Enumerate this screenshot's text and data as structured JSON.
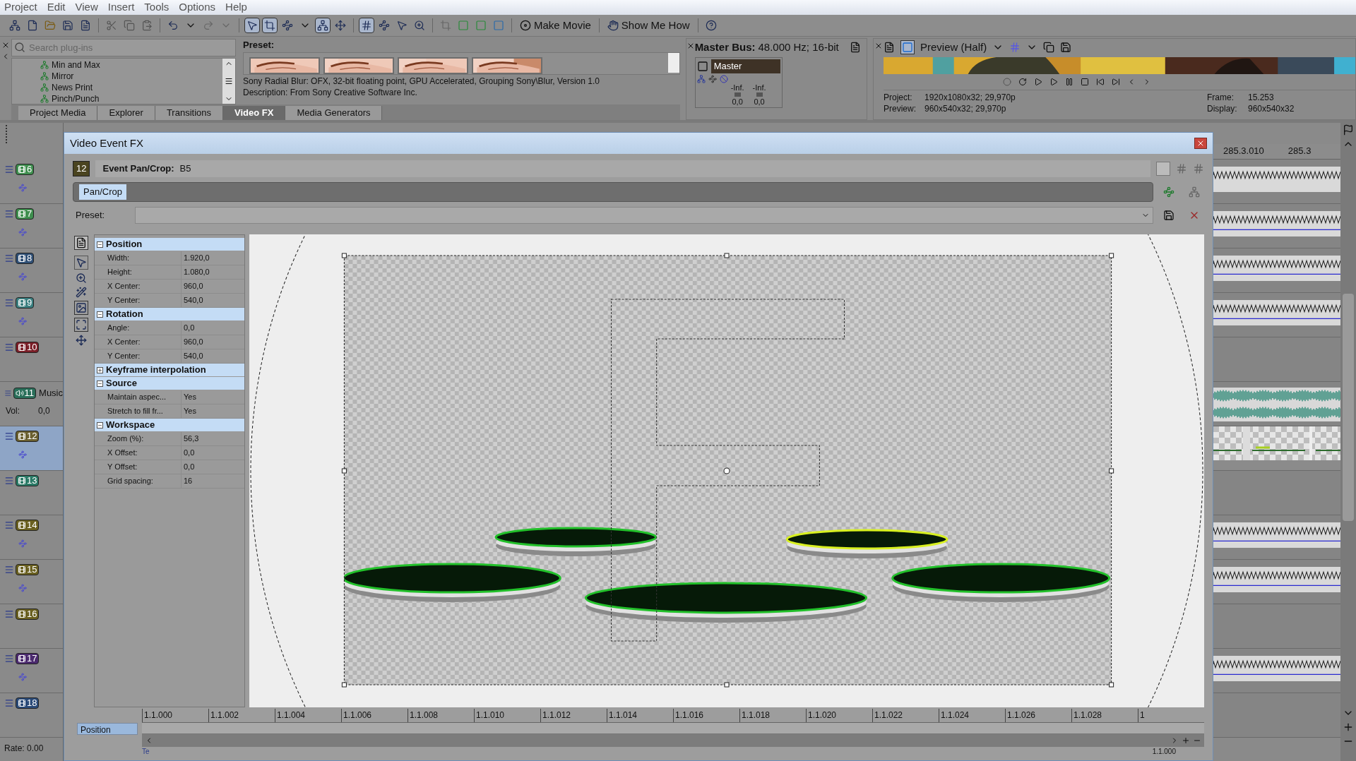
{
  "menu": [
    "Project",
    "Edit",
    "View",
    "Insert",
    "Tools",
    "Options",
    "Help"
  ],
  "toolbar": {
    "make_movie": "Make Movie",
    "show_me_how": "Show Me How"
  },
  "plugins": {
    "search_placeholder": "Search plug-ins",
    "items": [
      "Min and Max",
      "Mirror",
      "News Print",
      "Pinch/Punch"
    ],
    "preset_label": "Preset:",
    "info": "Sony Radial Blur: OFX, 32-bit floating point, GPU Accelerated, Grouping Sony\\Blur, Version 1.0",
    "description": "Description: From Sony Creative Software Inc."
  },
  "dock_tabs": [
    {
      "label": "Project Media",
      "selected": false
    },
    {
      "label": "Explorer",
      "selected": false
    },
    {
      "label": "Transitions",
      "selected": false
    },
    {
      "label": "Video FX",
      "selected": true
    },
    {
      "label": "Media Generators",
      "selected": false
    }
  ],
  "master_bus": {
    "title": "Master Bus:",
    "format": "48.000 Hz; 16-bit",
    "channel": "Master",
    "meters": [
      {
        "peak": "-Inf.",
        "value": "0,0"
      },
      {
        "peak": "-Inf.",
        "value": "0,0"
      }
    ]
  },
  "preview": {
    "mode": "Preview (Half)",
    "info": [
      {
        "label": "Project:",
        "value": "1920x1080x32; 29,970p"
      },
      {
        "label": "Preview:",
        "value": "960x540x32; 29,970p"
      },
      {
        "label": "Frame:",
        "value": "15.253"
      },
      {
        "label": "Display:",
        "value": "960x540x32"
      }
    ]
  },
  "tracks": [
    {
      "number": "6",
      "kind": "video",
      "color": "#3f8f4f",
      "selected": false,
      "event": true
    },
    {
      "number": "7",
      "kind": "video",
      "color": "#3f8f4f",
      "selected": false,
      "event": true
    },
    {
      "number": "8",
      "kind": "video",
      "color": "#2f4f75",
      "selected": false,
      "event": true
    },
    {
      "number": "9",
      "kind": "video",
      "color": "#3a7f80",
      "selected": false,
      "event": true
    },
    {
      "number": "10",
      "kind": "video",
      "color": "#7a1f28",
      "selected": false,
      "event": false
    },
    {
      "number": "11",
      "kind": "audio",
      "color": "#2a6f5a",
      "selected": false,
      "event": true,
      "name": "Music",
      "volume_label": "Vol:",
      "volume": "0,0"
    },
    {
      "number": "12",
      "kind": "video",
      "color": "#6b6030",
      "selected": true,
      "event": true
    },
    {
      "number": "13",
      "kind": "video",
      "color": "#2a7a66",
      "selected": false,
      "event": false
    },
    {
      "number": "14",
      "kind": "video",
      "color": "#6a6020",
      "selected": false,
      "event": true
    },
    {
      "number": "15",
      "kind": "video",
      "color": "#6a6020",
      "selected": false,
      "event": true
    },
    {
      "number": "16",
      "kind": "video",
      "color": "#6a6020",
      "selected": false,
      "event": false
    },
    {
      "number": "17",
      "kind": "video",
      "color": "#4b2a6e",
      "selected": false,
      "event": true
    },
    {
      "number": "18",
      "kind": "video",
      "color": "#2a4a78",
      "selected": false,
      "event": false
    }
  ],
  "rate": "Rate: 0.00",
  "timeline": {
    "ruler": [
      "285.3.010",
      "285.3"
    ]
  },
  "dialog": {
    "title": "Video Event FX",
    "track": "12",
    "event_label": "Event Pan/Crop:",
    "event": "B5",
    "chain": [
      "Pan/Crop"
    ],
    "preset_label": "Preset:",
    "sections": [
      {
        "title": "Position",
        "expanded": true,
        "rows": [
          {
            "label": "Width:",
            "value": "1.920,0"
          },
          {
            "label": "Height:",
            "value": "1.080,0"
          },
          {
            "label": "X Center:",
            "value": "960,0"
          },
          {
            "label": "Y Center:",
            "value": "540,0"
          }
        ]
      },
      {
        "title": "Rotation",
        "expanded": true,
        "rows": [
          {
            "label": "Angle:",
            "value": "0,0"
          },
          {
            "label": "X Center:",
            "value": "960,0"
          },
          {
            "label": "Y Center:",
            "value": "540,0"
          }
        ]
      },
      {
        "title": "Keyframe interpolation",
        "expanded": false
      },
      {
        "title": "Source",
        "expanded": true,
        "rows": [
          {
            "label": "Maintain aspec...",
            "value": "Yes"
          },
          {
            "label": "Stretch to fill fr...",
            "value": "Yes"
          }
        ]
      },
      {
        "title": "Workspace",
        "expanded": true,
        "rows": [
          {
            "label": "Zoom (%):",
            "value": "56,3"
          },
          {
            "label": "X Offset:",
            "value": "0,0"
          },
          {
            "label": "Y Offset:",
            "value": "0,0"
          },
          {
            "label": "Grid spacing:",
            "value": "16"
          }
        ]
      }
    ],
    "keyframe_ruler": [
      "1.1.000",
      "1.1.002",
      "1.1.004",
      "1.1.006",
      "1.1.008",
      "1.1.010",
      "1.1.012",
      "1.1.014",
      "1.1.016",
      "1.1.018",
      "1.1.020",
      "1.1.022",
      "1.1.024",
      "1.1.026",
      "1.1.028",
      "1"
    ],
    "keyframe_tracks": [
      "Position"
    ],
    "bottom_tab": "Te",
    "cursor": "1.1.000"
  }
}
